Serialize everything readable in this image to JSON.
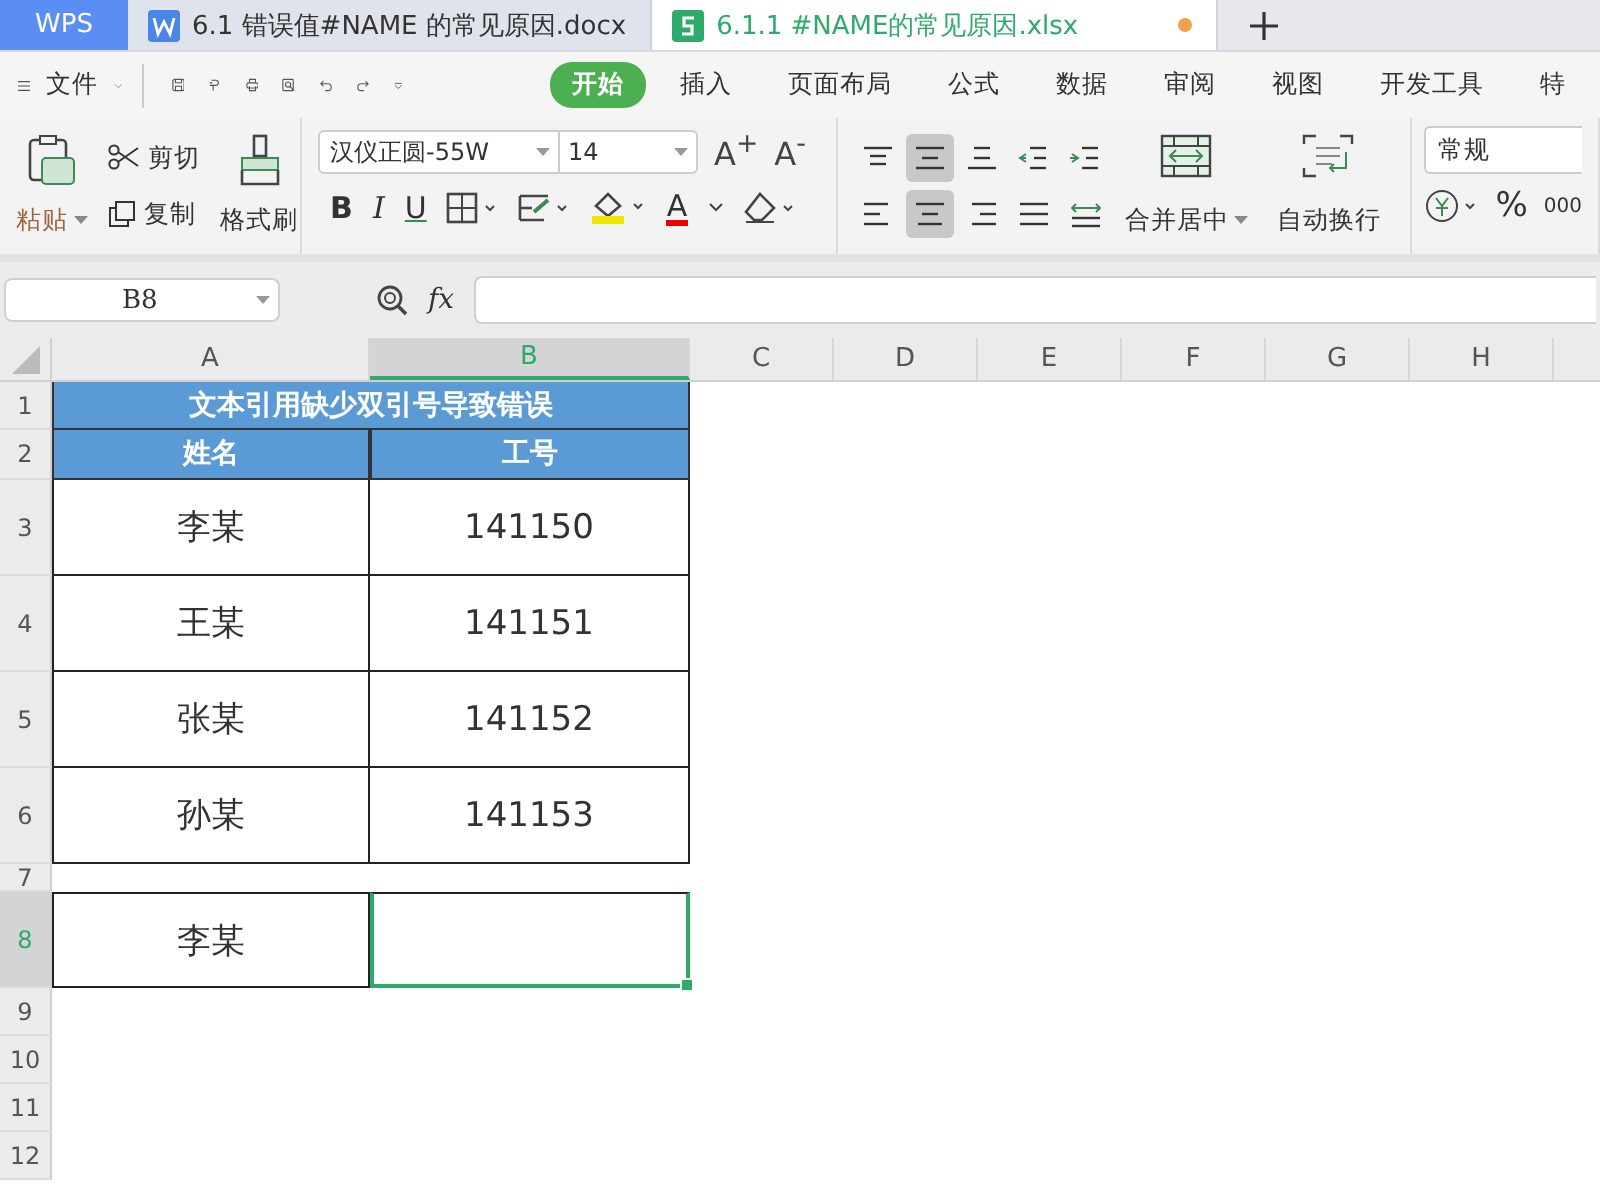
{
  "tabs": [
    {
      "kind": "home",
      "label": "WPS"
    },
    {
      "kind": "writer",
      "label": "6.1 错误值#NAME 的常见原因.docx",
      "selected": false,
      "modified": false
    },
    {
      "kind": "sheet",
      "label": "6.1.1 #NAME的常见原因.xlsx",
      "selected": true,
      "modified": true
    }
  ],
  "menu": {
    "file": "文件",
    "ribbon_tabs": [
      {
        "label": "开始",
        "selected": true
      },
      {
        "label": "插入",
        "selected": false
      },
      {
        "label": "页面布局",
        "selected": false
      },
      {
        "label": "公式",
        "selected": false
      },
      {
        "label": "数据",
        "selected": false
      },
      {
        "label": "审阅",
        "selected": false
      },
      {
        "label": "视图",
        "selected": false
      },
      {
        "label": "开发工具",
        "selected": false
      },
      {
        "label": "特",
        "selected": false
      }
    ]
  },
  "ribbon": {
    "clipboard": {
      "paste": "粘贴",
      "cut": "剪切",
      "copy": "复制",
      "painter": "格式刷"
    },
    "font": {
      "name": "汉仪正圆-55W",
      "size": "14",
      "grow": "A$^{+}$",
      "shrink": "A$^{-}$",
      "styles": [
        "B",
        "I",
        "U"
      ],
      "color_letter": "A"
    },
    "alignment": {
      "buttons": [
        {
          "kind": "top",
          "selected": false
        },
        {
          "kind": "middle",
          "selected": true
        },
        {
          "kind": "bottom",
          "selected": false
        },
        {
          "kind": "outdent",
          "selected": false
        },
        {
          "kind": "indent",
          "selected": false
        },
        {
          "kind": "left",
          "selected": false
        },
        {
          "kind": "center",
          "selected": true
        },
        {
          "kind": "right",
          "selected": false
        },
        {
          "kind": "justify",
          "selected": false
        },
        {
          "kind": "distributed",
          "selected": false
        }
      ],
      "merge": "合并居中",
      "wrap": "自动换行"
    },
    "number": {
      "format": "常规",
      "percent": "%",
      "thousands": "000"
    }
  },
  "formula_bar": {
    "name_box": "B8",
    "fx": "fx"
  },
  "columns": [
    {
      "label": "A",
      "selected": false
    },
    {
      "label": "B",
      "selected": true
    },
    {
      "label": "C",
      "selected": false
    },
    {
      "label": "D",
      "selected": false
    },
    {
      "label": "E",
      "selected": false
    },
    {
      "label": "F",
      "selected": false
    },
    {
      "label": "G",
      "selected": false
    },
    {
      "label": "H",
      "selected": false
    }
  ],
  "rows": [
    {
      "number": "1",
      "selected": false,
      "kind": "title",
      "cells": [
        {
          "text": "文本引用缺少双引号导致错误"
        }
      ]
    },
    {
      "number": "2",
      "selected": false,
      "kind": "header",
      "cells": [
        {
          "text": "姓名"
        },
        {
          "text": "工号"
        }
      ]
    },
    {
      "number": "3",
      "selected": false,
      "kind": "data",
      "cells": [
        {
          "text": "李某"
        },
        {
          "text": "141150"
        }
      ]
    },
    {
      "number": "4",
      "selected": false,
      "kind": "data",
      "cells": [
        {
          "text": "王某"
        },
        {
          "text": "141151"
        }
      ]
    },
    {
      "number": "5",
      "selected": false,
      "kind": "data",
      "cells": [
        {
          "text": "张某"
        },
        {
          "text": "141152"
        }
      ]
    },
    {
      "number": "6",
      "selected": false,
      "kind": "data",
      "cells": [
        {
          "text": "孙某"
        },
        {
          "text": "141153"
        }
      ]
    },
    {
      "number": "7",
      "selected": false,
      "kind": "spacer"
    },
    {
      "number": "8",
      "selected": true,
      "kind": "data",
      "cells": [
        {
          "text": "李某",
          "selected": false
        },
        {
          "selected": true
        }
      ]
    },
    {
      "number": "9",
      "selected": false,
      "kind": "empty"
    },
    {
      "number": "10",
      "selected": false,
      "kind": "empty"
    },
    {
      "number": "11",
      "selected": false,
      "kind": "empty"
    },
    {
      "number": "12",
      "selected": false,
      "kind": "empty"
    }
  ]
}
